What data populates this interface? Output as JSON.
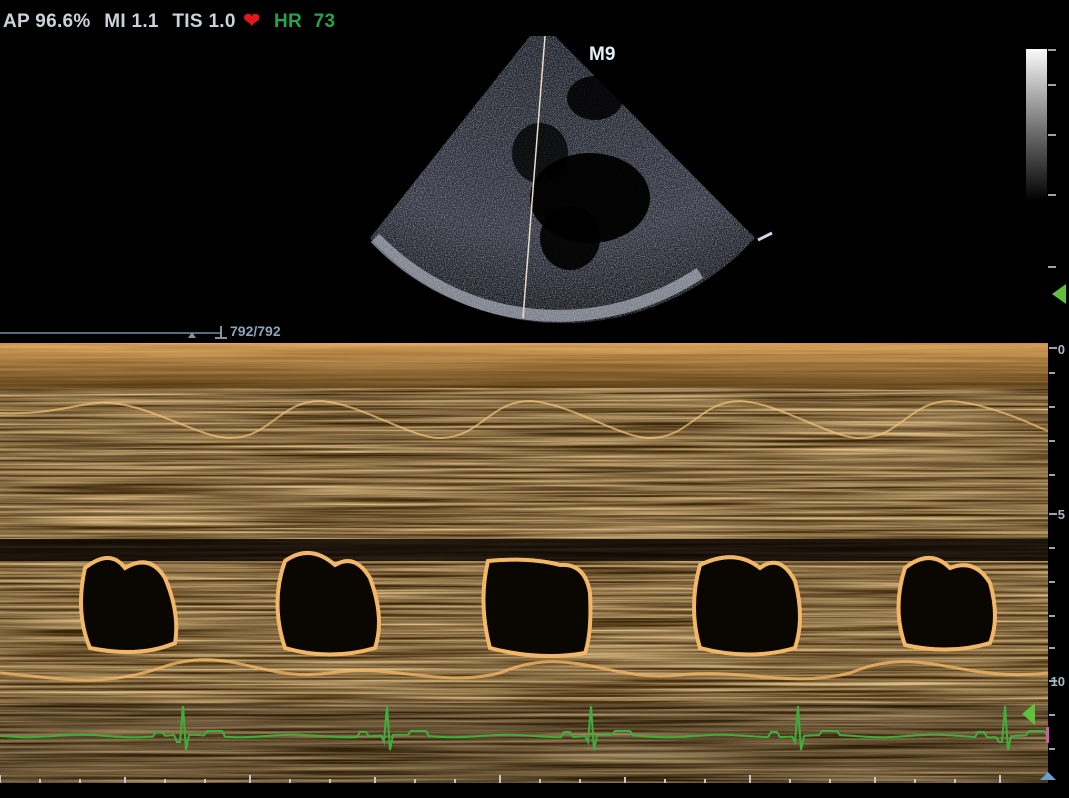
{
  "header": {
    "ap": "AP 96.6%",
    "mi": "MI 1.1",
    "tis": "TIS 1.0",
    "heart_icon": "heart-icon",
    "hr_label": "HR",
    "hr_value": "73"
  },
  "bmode": {
    "probe_label": "M9"
  },
  "cine": {
    "frame_counter": "792/792"
  },
  "depth_scale": {
    "labels": [
      "0",
      "5",
      "10"
    ]
  },
  "colors": {
    "ecg": "#3fae3a",
    "mmode_tint": "#e8a449",
    "hr": "#1fa54a",
    "heart": "#e2181e",
    "marker": "#5fc13b"
  }
}
